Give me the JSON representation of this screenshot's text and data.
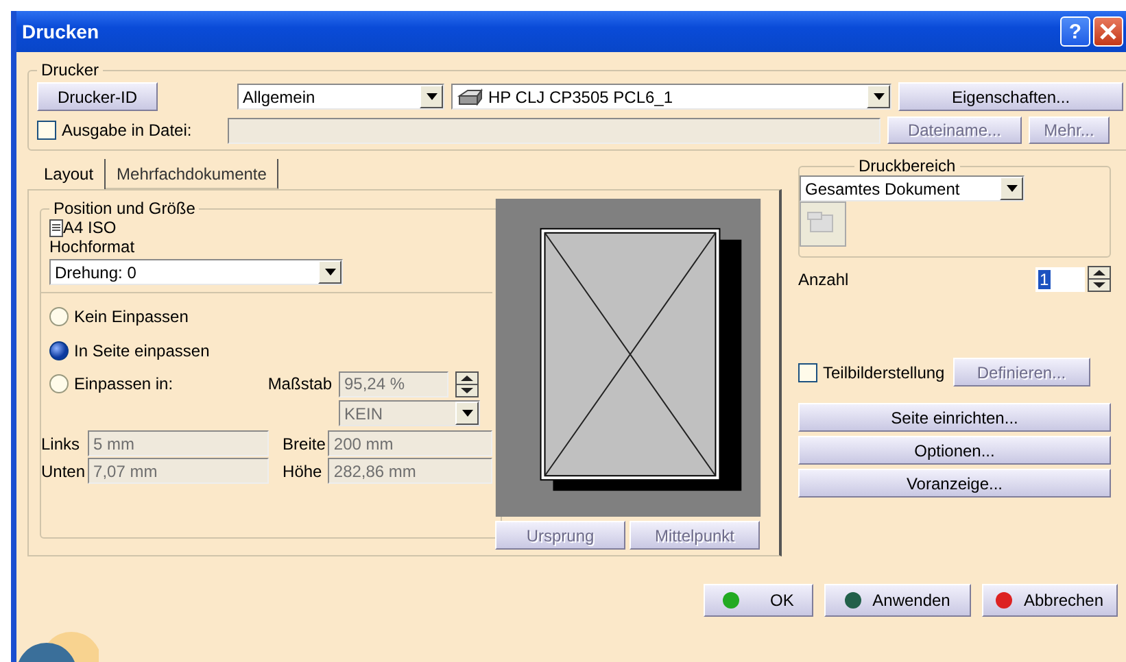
{
  "window": {
    "title": "Drucken",
    "help": "?"
  },
  "printer_group": {
    "legend": "Drucker",
    "id_button": "Drucker-ID",
    "category": "Allgemein",
    "printer": "HP CLJ CP3505 PCL6_1",
    "properties_button": "Eigenschaften...",
    "file_output": {
      "label": "Ausgabe in Datei:",
      "checked": false
    },
    "file_buttons": [
      {
        "label": "Dateiname...",
        "disabled": true
      },
      {
        "label": "Mehr...",
        "disabled": true
      }
    ]
  },
  "tabs": [
    {
      "label": "Layout",
      "selected": true
    },
    {
      "label": "Mehrfachdokumente",
      "selected": false
    }
  ],
  "position": {
    "legend": "Position und Größe",
    "paper": "A4 ISO",
    "orientation": "Hochformat",
    "rotation": "Drehung: 0",
    "fit_options": [
      {
        "label": "Kein Einpassen",
        "selected": false
      },
      {
        "label": "In Seite einpassen",
        "selected": true
      },
      {
        "label": "Einpassen in:",
        "selected": false
      }
    ],
    "scale_label": "Maßstab",
    "scale": "95,24 %",
    "scale_unit": "KEIN",
    "fields": [
      {
        "label": "Links",
        "value": "5 mm"
      },
      {
        "label": "Breite",
        "value": "200 mm"
      },
      {
        "label": "Unten",
        "value": "7,07 mm"
      },
      {
        "label": "Höhe",
        "value": "282,86 mm"
      }
    ]
  },
  "preview": {
    "buttons": [
      {
        "label": "Ursprung",
        "disabled": true
      },
      {
        "label": "Mittelpunkt",
        "disabled": true
      }
    ]
  },
  "print_range": {
    "legend": "Druckbereich",
    "value": "Gesamtes Dokument"
  },
  "copies": {
    "label": "Anzahl",
    "value": "1"
  },
  "tiling": {
    "label": "Teilbilderstellung",
    "checked": false,
    "button": {
      "label": "Definieren...",
      "disabled": true
    }
  },
  "side_buttons": [
    "Seite einrichten...",
    "Optionen...",
    "Voranzeige..."
  ],
  "dialog_buttons": [
    {
      "label": "OK",
      "color": "#22aa22"
    },
    {
      "label": "Anwenden",
      "color": "#22604a"
    },
    {
      "label": "Abbrechen",
      "color": "#dd2222"
    }
  ]
}
